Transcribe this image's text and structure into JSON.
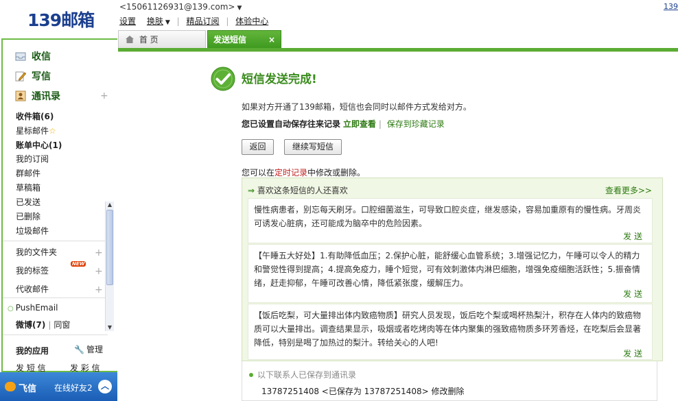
{
  "logo_text": "139邮箱",
  "account": {
    "email": "<15061126931@139.com>"
  },
  "top_links": {
    "settings": "设置",
    "skin": "换肤",
    "subscribe": "精品订阅",
    "experience": "体验中心"
  },
  "corner_link": "139",
  "tabs": [
    {
      "label": "首 页"
    },
    {
      "label": "发送短信",
      "close": "×"
    }
  ],
  "sidebar": {
    "main_items": [
      {
        "label": "收信"
      },
      {
        "label": "写信"
      },
      {
        "label": "通讯录",
        "plus": "+"
      }
    ],
    "folders": [
      "收件箱(6)",
      "星标邮件",
      "账单中心(1)",
      "我的订阅",
      "群邮件",
      "草稿箱",
      "已发送",
      "已删除",
      "垃圾邮件"
    ],
    "groups": [
      "我的文件夹",
      "我的标签",
      "代收邮件"
    ],
    "new_badge": "NEW",
    "pushemail": "PushEmail",
    "weibo": "微博(7)",
    "tongchuang": "同窗",
    "myapps": "我的应用",
    "manage": "管理",
    "apps_cut": [
      "发 短 信",
      "发 彩 信"
    ]
  },
  "feixin": {
    "name": "飞信",
    "online": "在线好友2"
  },
  "main": {
    "title": "短信发送完成!",
    "info1": "如果对方开通了139邮箱，短信也会同时以邮件方式发给对方。",
    "info2_bold": "您已设置自动保存往来记录",
    "info2_link1": "立即查看",
    "info2_link2": "保存到珍藏记录",
    "btn_back": "返回",
    "btn_continue": "继续写短信",
    "info3_pre": "您可以在",
    "info3_link": "定时记录",
    "info3_post": "中修改或删除。"
  },
  "recommend": {
    "head": "喜欢这条短信的人还喜欢",
    "more": "查看更多>>",
    "send_label": "发 送",
    "messages": [
      "慢性病患者，别忘每天刷牙。口腔细菌滋生，可导致口腔炎症，继发感染，容易加重原有的慢性病。牙周炎可诱发心脏病，还可能成为脑卒中的危险因素。",
      "【午睡五大好处】1.有助降低血压；2.保护心脏，能舒缓心血管系统；3.增强记忆力，午睡可以令人的精力和警觉性得到提高；4.提高免疫力，睡个短觉，可有效刺激体内淋巴细胞，增强免疫细胞活跃性；5.振奋情绪，赶走抑郁，午睡可改善心情，降低紧张度，缓解压力。",
      "【饭后吃梨，可大量排出体内致癌物质】研究人员发现，饭后吃个梨或喝杯热梨汁，积存在人体内的致癌物质可以大量排出。调查结果显示，吸烟或者吃烤肉等在体内聚集的强致癌物质多环芳香烃，在吃梨后会显著降低，特别是喝了加热过的梨汁。转给关心的人吧!"
    ]
  },
  "saved": {
    "title": "以下联系人已保存到通讯录",
    "row": "13787251408 <已保存为 13787251408> 修改删除"
  }
}
